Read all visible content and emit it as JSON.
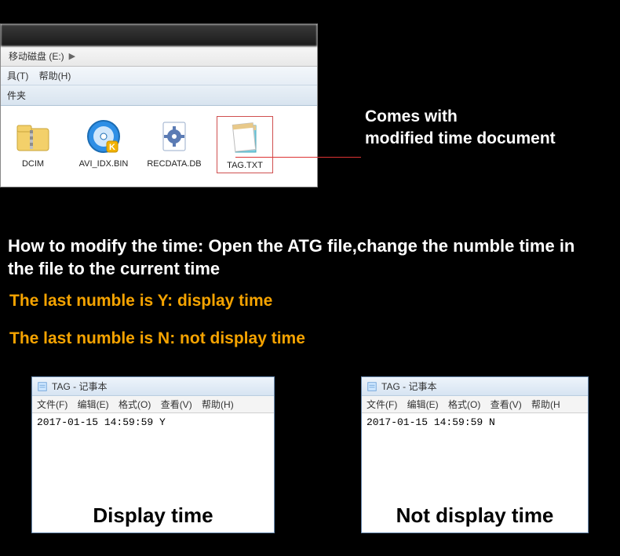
{
  "explorer": {
    "address": "移动磁盘 (E:)",
    "menu": {
      "tools": "具(T)",
      "help": "帮助(H)"
    },
    "toolbar_label": "件夹",
    "items": [
      {
        "label": "DCIM"
      },
      {
        "label": "AVI_IDX.BIN"
      },
      {
        "label": "RECDATA.DB"
      },
      {
        "label": "TAG.TXT"
      }
    ]
  },
  "callout": {
    "line1": "Comes with",
    "line2": "modified time document"
  },
  "instruction": "How to modify the time: Open the ATG file,change the numble time in the file to the current time",
  "rule_y": "The last numble is Y: display time",
  "rule_n": "The last numble is N: not display time",
  "notepad": {
    "title": "TAG - 记事本",
    "menu": {
      "file": "文件(F)",
      "edit": "编辑(E)",
      "format": "格式(O)",
      "view": "查看(V)",
      "help": "帮助(H)",
      "help_short": "帮助(H"
    },
    "content_y": "2017-01-15 14:59:59  Y",
    "content_n": "2017-01-15 14:59:59  N",
    "caption_y": "Display time",
    "caption_n": "Not display time"
  }
}
